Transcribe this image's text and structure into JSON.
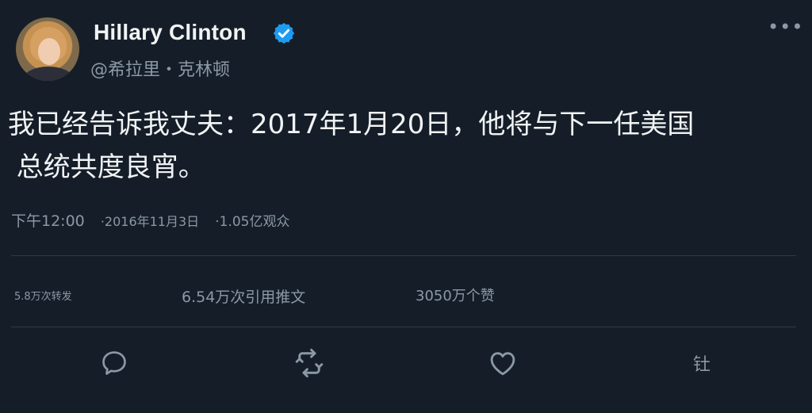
{
  "author": {
    "display_name": "Hillary Clinton",
    "handle": "@希拉里・克林顿",
    "verified": true,
    "verified_color": "#1d9bf0"
  },
  "tweet": {
    "line1": "我已经告诉我丈夫：2017年1月20日，他将与下一任美国",
    "line2": " 总统共度良宵。"
  },
  "meta": {
    "time": "下午12:00",
    "date": "·2016年11月3日",
    "views": "·1.05亿观众"
  },
  "stats": {
    "retweets": "5.8万次转发",
    "quotes": "6.54万次引用推文",
    "likes": "3050万个赞"
  },
  "actions": {
    "reply_icon": "reply-icon",
    "retweet_icon": "retweet-icon",
    "like_icon": "like-icon",
    "share_label": "钍"
  },
  "colors": {
    "background": "#151e28",
    "text": "#f1f3f4",
    "secondary": "#8b98a5",
    "divider": "#2f3a45"
  }
}
